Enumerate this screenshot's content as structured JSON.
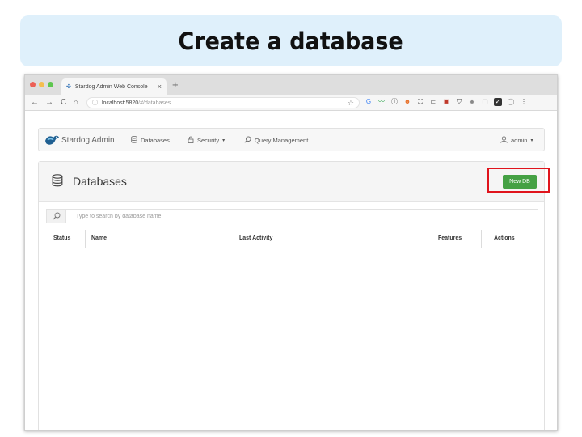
{
  "slide": {
    "title": "Create a database"
  },
  "browser": {
    "tab": {
      "title": "Stardog Admin Web Console",
      "close": "×"
    },
    "new_tab": "+",
    "nav": {
      "back": "←",
      "forward": "→",
      "reload": "C",
      "home": "⌂"
    },
    "url": {
      "host": "localhost:5820",
      "path": "/#/databases"
    },
    "bookmark": "☆",
    "extensions": [
      {
        "name": "google-icon",
        "glyph": "G",
        "color": "#4285f4"
      },
      {
        "name": "analytics-icon",
        "glyph": "〰",
        "color": "#34a853"
      },
      {
        "name": "ext-info-icon",
        "glyph": "ⓘ",
        "color": "#222222"
      },
      {
        "name": "ext-face-icon",
        "glyph": "☻",
        "color": "#e8712b"
      },
      {
        "name": "screenshot-icon",
        "glyph": "⛶",
        "color": "#333333"
      },
      {
        "name": "cast-icon",
        "glyph": "⊏",
        "color": "#555555"
      },
      {
        "name": "ext-book-icon",
        "glyph": "▣",
        "color": "#c0392b"
      },
      {
        "name": "shield-icon",
        "glyph": "⛉",
        "color": "#444444"
      },
      {
        "name": "ext-gray-icon",
        "glyph": "◉",
        "color": "#888888"
      },
      {
        "name": "ext-square-icon",
        "glyph": "▢",
        "color": "#7a7a7a"
      },
      {
        "name": "ext-check-icon",
        "glyph": "✓",
        "color": "#ffffff"
      },
      {
        "name": "profile-icon",
        "glyph": "◯",
        "color": "#888888"
      },
      {
        "name": "menu-dots-icon",
        "glyph": "⋮",
        "color": "#555555"
      }
    ]
  },
  "app": {
    "brand": "Stardog Admin",
    "nav": {
      "databases": "Databases",
      "security": "Security",
      "query_management": "Query Management",
      "user": "admin",
      "caret": "▾"
    },
    "panel": {
      "title": "Databases",
      "new_db": "New DB",
      "search_placeholder": "Type to search by database name",
      "columns": {
        "status": "Status",
        "name": "Name",
        "last_activity": "Last Activity",
        "features": "Features",
        "actions": "Actions"
      }
    }
  },
  "colors": {
    "banner": "#dff0fb",
    "primary_button": "#45a144",
    "highlight": "#e0141c"
  }
}
